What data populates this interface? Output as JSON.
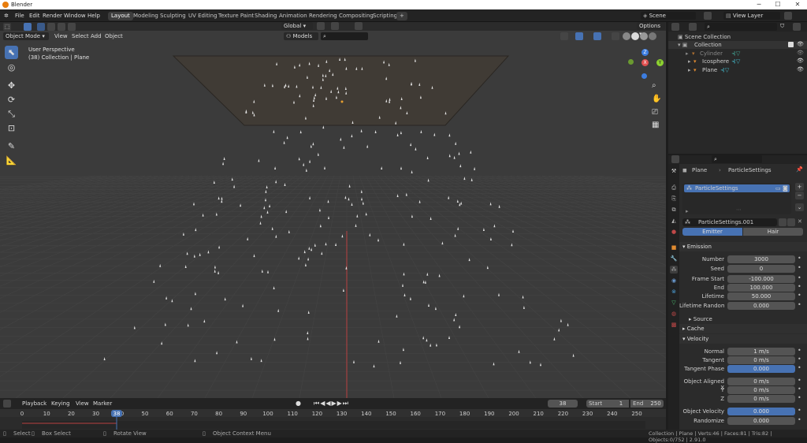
{
  "window": {
    "title": "Blender",
    "minimize": "─",
    "maximize": "☐",
    "close": "✕"
  },
  "menus": [
    "File",
    "Edit",
    "Render",
    "Window",
    "Help"
  ],
  "workspaces": [
    "Layout",
    "Modeling",
    "Sculpting",
    "UV Editing",
    "Texture Paint",
    "Shading",
    "Animation",
    "Rendering",
    "Compositing",
    "Scripting",
    "+"
  ],
  "scene": {
    "name": "Scene",
    "view_layer": "View Layer"
  },
  "viewport": {
    "mode": "Object Mode",
    "menus": [
      "View",
      "Select",
      "Add",
      "Object"
    ],
    "transform": "Global",
    "options": "Options",
    "models_label": "Models",
    "info_line1": "User Perspective",
    "info_line2": "(38) Collection | Plane",
    "gizmo_x": "X",
    "gizmo_y": "Y",
    "gizmo_z": "Z"
  },
  "tools": [
    "select-box",
    "cursor",
    "move",
    "rotate",
    "scale",
    "transform",
    "annotate",
    "measure"
  ],
  "timeline": {
    "menus": [
      "Playback",
      "Keying",
      "View",
      "Marker"
    ],
    "current_frame": "38",
    "start_label": "Start",
    "start": "1",
    "end_label": "End",
    "end": "250",
    "ticks": [
      "0",
      "10",
      "20",
      "30",
      "40",
      "50",
      "60",
      "70",
      "80",
      "90",
      "100",
      "110",
      "120",
      "130",
      "140",
      "150",
      "160",
      "170",
      "180",
      "190",
      "200",
      "210",
      "220",
      "230",
      "240",
      "250"
    ]
  },
  "status": {
    "select": "Select",
    "box_select": "Box Select",
    "rotate_view": "Rotate View",
    "context_menu": "Object Context Menu",
    "stats": "Collection | Plane | Verts:46 | Faces:81 | Tris:82 | Objects:0/752 | 2.91.0"
  },
  "outliner": {
    "root": "Scene Collection",
    "collection": "Collection",
    "items": [
      {
        "name": "Cylinder",
        "dim": true
      },
      {
        "name": "Icosphere",
        "dim": false
      },
      {
        "name": "Plane",
        "dim": false
      }
    ]
  },
  "properties": {
    "breadcrumb_object": "Plane",
    "breadcrumb_settings": "ParticleSettings",
    "slot": "ParticleSettings",
    "settings_name": "ParticleSettings.001",
    "type_emitter": "Emitter",
    "type_hair": "Hair",
    "emission_header": "Emission",
    "number_label": "Number",
    "number": "3000",
    "seed_label": "Seed",
    "seed": "0",
    "frame_start_label": "Frame Start",
    "frame_start": "-100.000",
    "end_label": "End",
    "end": "100.000",
    "lifetime_label": "Lifetime",
    "lifetime": "50.000",
    "lifetime_random_label": "Lifetime Randomn...",
    "lifetime_random": "0.000",
    "source_header": "Source",
    "cache_header": "Cache",
    "velocity_header": "Velocity",
    "normal_label": "Normal",
    "normal": "1 m/s",
    "tangent_label": "Tangent",
    "tangent": "0 m/s",
    "tangent_phase_label": "Tangent Phase",
    "tangent_phase": "0.000",
    "obj_aligned_label": "Object Aligned X",
    "obj_aligned_x": "0 m/s",
    "y_label": "Y",
    "obj_aligned_y": "0 m/s",
    "z_label": "Z",
    "obj_aligned_z": "0 m/s",
    "object_velocity_label": "Object Velocity",
    "object_velocity": "0.000",
    "randomize_label": "Randomize",
    "randomize": "0.000"
  },
  "colors": {
    "accent": "#4772b3",
    "viewport_bg": "#3b3b3b",
    "plane_fill": "#403b35",
    "x_axis": "#c04848"
  }
}
